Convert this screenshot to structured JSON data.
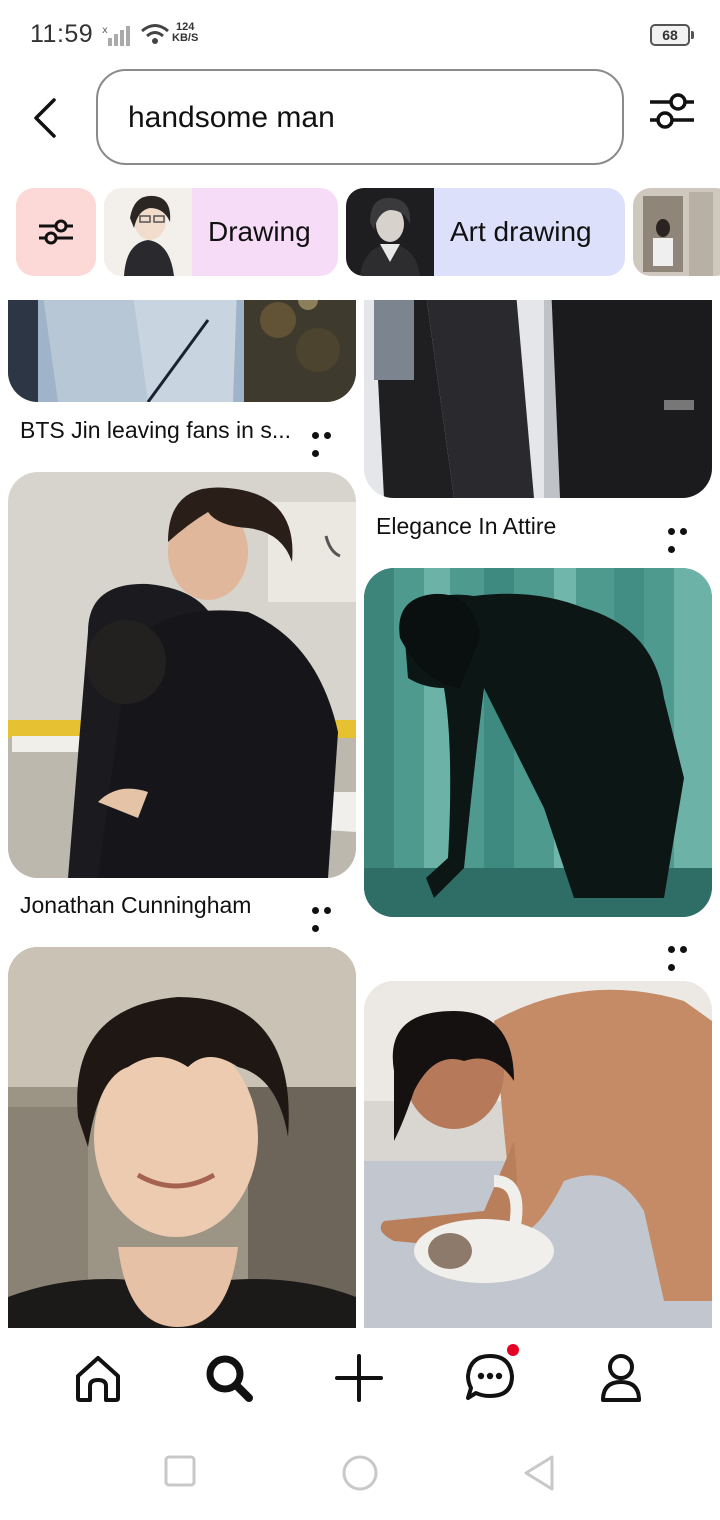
{
  "status_bar": {
    "time": "11:59",
    "net_speed_value": "124",
    "net_speed_unit": "KB/S",
    "battery": "68"
  },
  "search": {
    "query": "handsome man",
    "back_icon": "chevron-left-icon",
    "filter_icon": "sliders-icon"
  },
  "chips": [
    {
      "label": "Drawing"
    },
    {
      "label": "Art drawing"
    }
  ],
  "pins": [
    {
      "caption": "BTS Jin leaving fans in s..."
    },
    {
      "caption": "Elegance In Attire"
    },
    {
      "caption": "Jonathan Cunningham"
    },
    {
      "caption": ""
    },
    {
      "caption": ""
    },
    {
      "caption": ""
    }
  ],
  "bottom_nav": {
    "items": [
      "home-icon",
      "search-icon",
      "plus-icon",
      "chat-icon",
      "profile-icon"
    ],
    "accent": "#e60023"
  },
  "system_nav": [
    "recent-apps-icon",
    "home-circle-icon",
    "back-triangle-icon"
  ]
}
